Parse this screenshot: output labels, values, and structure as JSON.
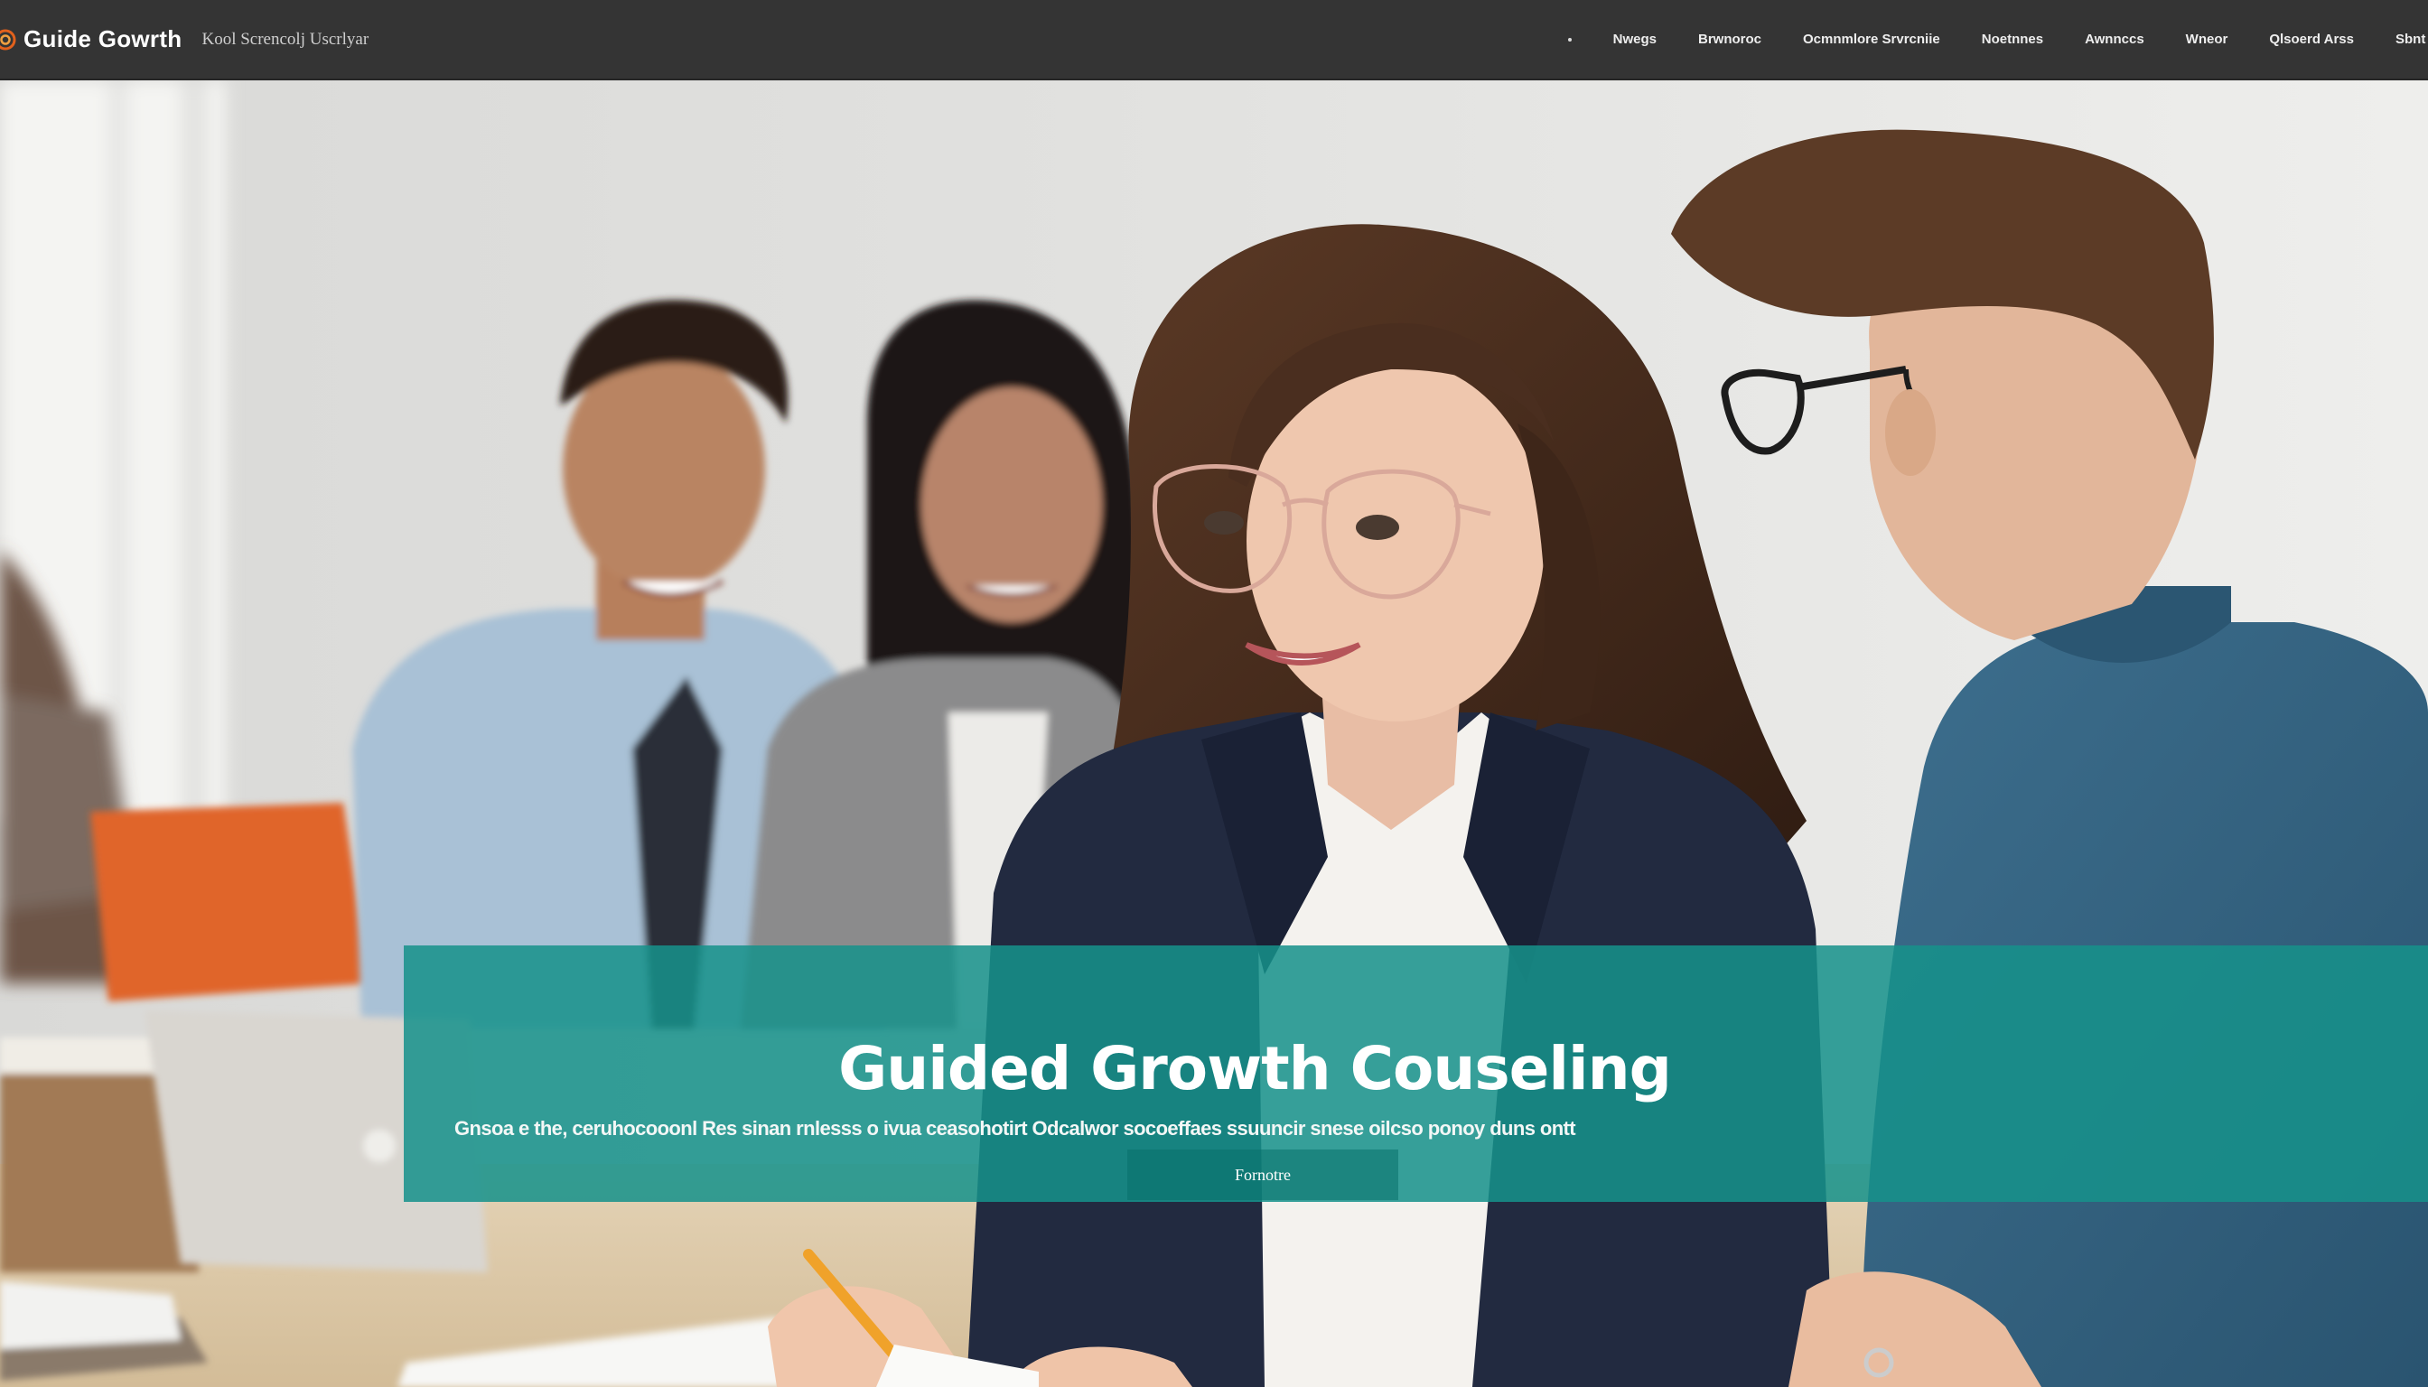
{
  "header": {
    "brand_name": "Guide Gowrth",
    "tagline": "Kool Screncolj Uscrlyar",
    "nav_items": [
      "Nwegs",
      "Brwnoroc",
      "Ocmnmlore Srvrcniie",
      "Noetnnes",
      "Awnnccs",
      "Wneor",
      "Qlsoerd Arss",
      "Sbnt"
    ]
  },
  "hero": {
    "title": "Guided Growth Couseling",
    "description": "Gnsoa e the, ceruhocooonl Res sinan rnlesss o ivua ceasohotirt Odcalwor socoeffaes ssuuncir snese oilcso ponoy duns ontt",
    "cta_label": "Fornotre"
  },
  "colors": {
    "nav_background": "#343434",
    "banner_teal": "#16918b",
    "logo_orange": "#e2611c"
  },
  "icons": {
    "logo": "spiral-logo-icon"
  }
}
